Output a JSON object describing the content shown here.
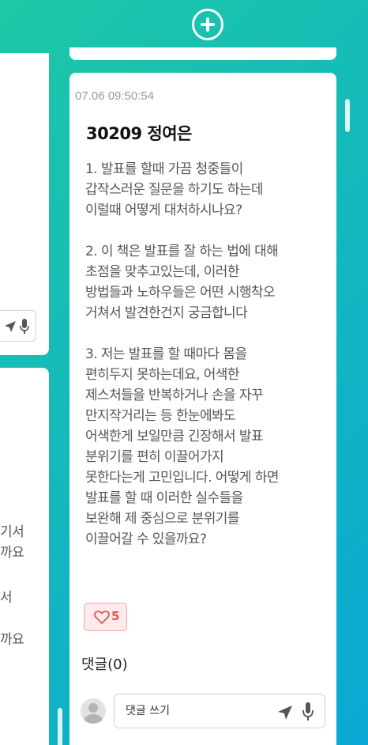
{
  "post": {
    "timestamp": "07.06 09:50:54",
    "title": "30209 정여은",
    "content": "1. 발표를 할때 가끔 청중들이\n갑작스러운 질문을 하기도 하는데\n이럴때 어떻게 대처하시나요?\n\n2. 이 책은 발표를 잘 하는 법에 대해\n초점을 맞추고있는데, 이러한\n방법들과 노하우들은 어떤 시행착오\n거쳐서 발견한건지 궁금합니다\n\n3. 저는 발표를 할 때마다 몸을\n편히두지 못하는데요, 어색한\n제스처들을 반복하거나 손을 자꾸\n만지작거리는 등 한눈에봐도\n어색한게 보일만큼 긴장해서 발표\n분위기를 편히 이끌어가지\n못한다는게 고민입니다. 어떻게 하면\n발표를 할 때 이러한 실수들을\n보완해 제 중심으로 분위기를\n이끌어갈 수 있을까요?",
    "likes": "5",
    "comments_label": "댓글(0)",
    "comment_placeholder": "댓글 쓰기"
  },
  "left_column": {
    "text_lines": [
      "기서",
      "까요",
      "서",
      "까요"
    ]
  },
  "colors": {
    "background_start": "#1dc8a6",
    "background_end": "#0aa8d4",
    "like_accent": "#e25555"
  },
  "icons": [
    "add-icon",
    "heart-icon",
    "send-icon",
    "mic-icon",
    "avatar-icon"
  ]
}
